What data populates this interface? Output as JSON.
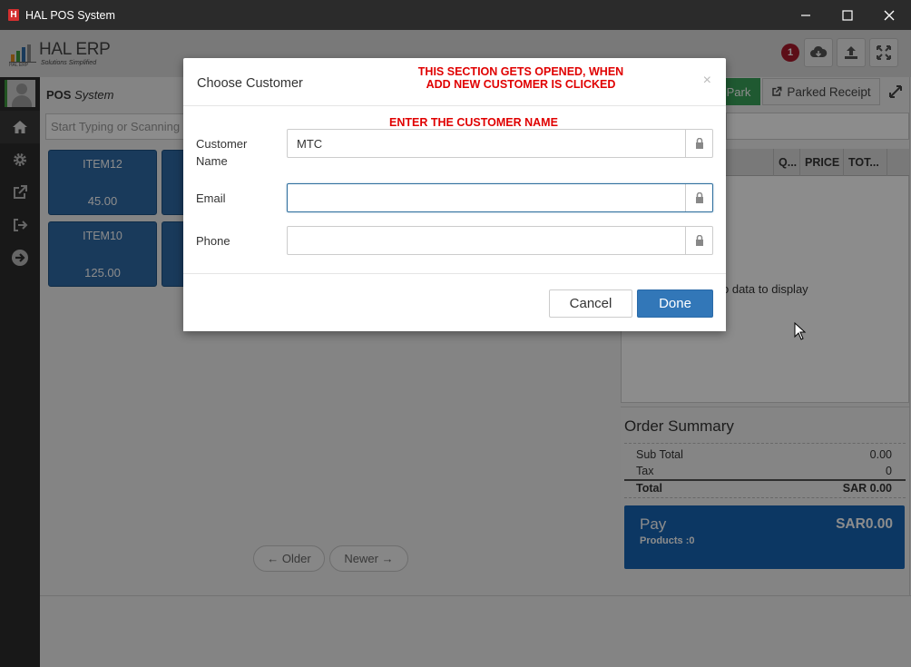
{
  "window": {
    "title": "HAL POS System",
    "minimize": "—",
    "maximize": "☐",
    "close": "✕"
  },
  "header": {
    "brand": "HAL ERP",
    "tagline": "Solutions Simplified",
    "mini_brand": "HAL ERP",
    "notification_count": "1"
  },
  "pos": {
    "label_bold": "POS",
    "label_italic": "System",
    "search_placeholder": "Start Typing or Scanning"
  },
  "items": [
    {
      "name": "ITEM12",
      "price": "45.00"
    },
    {
      "name": "ITEM10",
      "price": "125.00"
    }
  ],
  "pager": {
    "older": "← Older",
    "newer": "Newer →"
  },
  "cart": {
    "park_label": "Park",
    "parked_label": "Parked Receipt",
    "columns": [
      "Q...",
      "PRICE",
      "TOT..."
    ],
    "empty_text": "o data to display"
  },
  "summary": {
    "heading": "Order Summary",
    "subtotal_label": "Sub Total",
    "subtotal_value": "0.00",
    "tax_label": "Tax",
    "tax_value": "0",
    "total_label": "Total",
    "total_value": "SAR 0.00"
  },
  "pay": {
    "label": "Pay",
    "amount": "SAR0.00",
    "products": "Products :0"
  },
  "modal": {
    "title": "Choose Customer",
    "close": "×",
    "annotation_top": "THIS SECTION GETS OPENED, WHEN\nADD NEW CUSTOMER IS CLICKED",
    "annotation_name": "ENTER THE CUSTOMER NAME",
    "fields": {
      "name_label": "Customer\nName",
      "name_value": "MTC",
      "email_label": "Email",
      "email_value": "",
      "phone_label": "Phone",
      "phone_value": ""
    },
    "cancel_label": "Cancel",
    "done_label": "Done"
  },
  "colors": {
    "accent_blue": "#3277b8",
    "pay_blue": "#1765b5",
    "park_green": "#3aa35a",
    "annotation_red": "#e00000",
    "badge_red": "#a8182b"
  }
}
